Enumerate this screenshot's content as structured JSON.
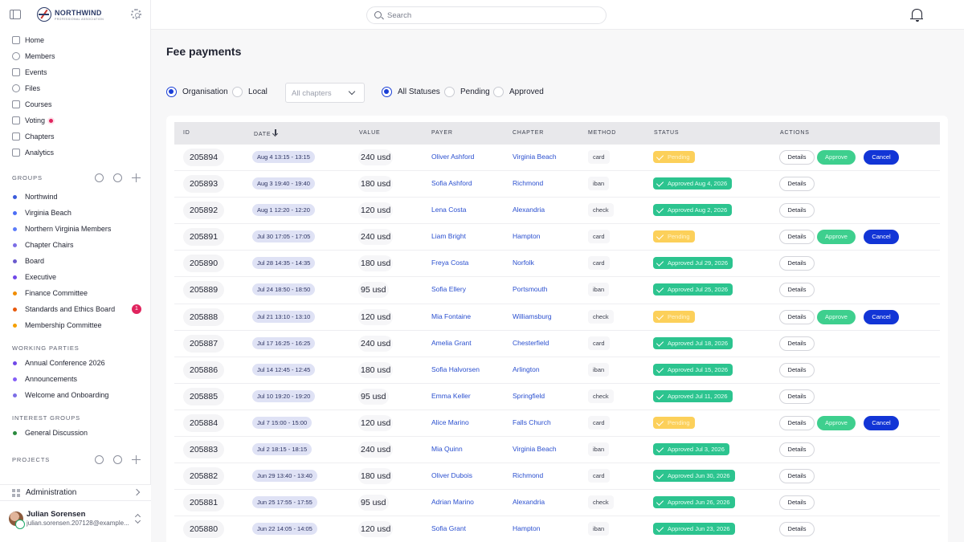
{
  "brand": {
    "name": "NORTHWIND",
    "tagline": "PROFESSIONAL ASSOCIATION"
  },
  "nav": [
    {
      "label": "Home",
      "icon": "home-icon"
    },
    {
      "label": "Members",
      "icon": "members-icon"
    },
    {
      "label": "Events",
      "icon": "calendar-icon"
    },
    {
      "label": "Files",
      "icon": "database-icon"
    },
    {
      "label": "Courses",
      "icon": "book-icon"
    },
    {
      "label": "Voting",
      "icon": "vote-icon"
    },
    {
      "label": "Chapters",
      "icon": "chapters-icon"
    },
    {
      "label": "Analytics",
      "icon": "analytics-icon"
    }
  ],
  "sections": {
    "groups": "GROUPS",
    "working_parties": "WORKING PARTIES",
    "interest_groups": "INTEREST GROUPS",
    "projects": "PROJECTS"
  },
  "groups": [
    {
      "label": "Northwind",
      "color": "#3b5bdb"
    },
    {
      "label": "Virginia Beach",
      "color": "#4c6ef5"
    },
    {
      "label": "Northern Virginia Members",
      "color": "#5c7cfa"
    },
    {
      "label": "Chapter Chairs",
      "color": "#7c6ee6"
    },
    {
      "label": "Board",
      "color": "#6a5acd"
    },
    {
      "label": "Executive",
      "color": "#7048e8"
    },
    {
      "label": "Finance Committee",
      "color": "#845ef7"
    },
    {
      "label": "Standards and Ethics Board",
      "color": "#f08c00",
      "badge": "1"
    },
    {
      "label": "Membership Committee",
      "color": "#f59f00"
    }
  ],
  "working_parties": [
    {
      "label": "Annual Conference 2026",
      "color": "#7048e8"
    },
    {
      "label": "Announcements",
      "color": "#845ef7"
    },
    {
      "label": "Welcome and Onboarding",
      "color": "#7c6ee6"
    }
  ],
  "interest_groups": [
    {
      "label": "General Discussion",
      "color": "#2b8a3e"
    }
  ],
  "admin": {
    "label": "Administration"
  },
  "user": {
    "name": "Julian Sorensen",
    "email": "julian.sorensen.207128@example..."
  },
  "search": {
    "placeholder": "Search"
  },
  "page": {
    "title": "Fee payments"
  },
  "filters": {
    "scope": [
      {
        "label": "Organisation",
        "selected": true
      },
      {
        "label": "Local",
        "selected": false
      }
    ],
    "chapter_select": "All chapters",
    "status": [
      {
        "label": "All Statuses",
        "selected": true
      },
      {
        "label": "Pending",
        "selected": false
      },
      {
        "label": "Approved",
        "selected": false
      }
    ]
  },
  "table": {
    "headers": [
      "ID",
      "DATE",
      "VALUE",
      "PAYER",
      "CHAPTER",
      "METHOD",
      "STATUS",
      "ACTIONS"
    ],
    "actions": {
      "details": "Details",
      "approve": "Approve",
      "cancel": "Cancel"
    },
    "rows": [
      {
        "id": "205894",
        "date": "Aug 4 13:15 - 13:15",
        "value": "240 usd",
        "payer": "Oliver Ashford",
        "chapter": "Virginia Beach",
        "method": "card",
        "status": "Pending",
        "pending": true
      },
      {
        "id": "205893",
        "date": "Aug 3 19:40 - 19:40",
        "value": "180 usd",
        "payer": "Sofia Ashford",
        "chapter": "Richmond",
        "method": "iban",
        "status": "Approved Aug 4, 2026",
        "pending": false
      },
      {
        "id": "205892",
        "date": "Aug 1 12:20 - 12:20",
        "value": "120 usd",
        "payer": "Lena Costa",
        "chapter": "Alexandria",
        "method": "check",
        "status": "Approved Aug 2, 2026",
        "pending": false
      },
      {
        "id": "205891",
        "date": "Jul 30 17:05 - 17:05",
        "value": "240 usd",
        "payer": "Liam Bright",
        "chapter": "Hampton",
        "method": "card",
        "status": "Pending",
        "pending": true
      },
      {
        "id": "205890",
        "date": "Jul 28 14:35 - 14:35",
        "value": "180 usd",
        "payer": "Freya Costa",
        "chapter": "Norfolk",
        "method": "card",
        "status": "Approved Jul 29, 2026",
        "pending": false
      },
      {
        "id": "205889",
        "date": "Jul 24 18:50 - 18:50",
        "value": "95 usd",
        "payer": "Sofia Ellery",
        "chapter": "Portsmouth",
        "method": "iban",
        "status": "Approved Jul 25, 2026",
        "pending": false
      },
      {
        "id": "205888",
        "date": "Jul 21 13:10 - 13:10",
        "value": "120 usd",
        "payer": "Mia Fontaine",
        "chapter": "Williamsburg",
        "method": "check",
        "status": "Pending",
        "pending": true
      },
      {
        "id": "205887",
        "date": "Jul 17 16:25 - 16:25",
        "value": "240 usd",
        "payer": "Amelia Grant",
        "chapter": "Chesterfield",
        "method": "card",
        "status": "Approved Jul 18, 2026",
        "pending": false
      },
      {
        "id": "205886",
        "date": "Jul 14 12:45 - 12:45",
        "value": "180 usd",
        "payer": "Sofia Halvorsen",
        "chapter": "Arlington",
        "method": "iban",
        "status": "Approved Jul 15, 2026",
        "pending": false
      },
      {
        "id": "205885",
        "date": "Jul 10 19:20 - 19:20",
        "value": "95 usd",
        "payer": "Emma Keller",
        "chapter": "Springfield",
        "method": "check",
        "status": "Approved Jul 11, 2026",
        "pending": false
      },
      {
        "id": "205884",
        "date": "Jul 7 15:00 - 15:00",
        "value": "120 usd",
        "payer": "Alice Marino",
        "chapter": "Falls Church",
        "method": "card",
        "status": "Pending",
        "pending": true
      },
      {
        "id": "205883",
        "date": "Jul 2 18:15 - 18:15",
        "value": "240 usd",
        "payer": "Mia Quinn",
        "chapter": "Virginia Beach",
        "method": "iban",
        "status": "Approved Jul 3, 2026",
        "pending": false
      },
      {
        "id": "205882",
        "date": "Jun 29 13:40 - 13:40",
        "value": "180 usd",
        "payer": "Oliver Dubois",
        "chapter": "Richmond",
        "method": "card",
        "status": "Approved Jun 30, 2026",
        "pending": false
      },
      {
        "id": "205881",
        "date": "Jun 25 17:55 - 17:55",
        "value": "95 usd",
        "payer": "Adrian Marino",
        "chapter": "Alexandria",
        "method": "check",
        "status": "Approved Jun 26, 2026",
        "pending": false
      },
      {
        "id": "205880",
        "date": "Jun 22 14:05 - 14:05",
        "value": "120 usd",
        "payer": "Sofia Grant",
        "chapter": "Hampton",
        "method": "iban",
        "status": "Approved Jun 23, 2026",
        "pending": false
      }
    ]
  },
  "colors": {
    "accent": "#1235d6",
    "link": "#2a4fcf",
    "approved": "#2cc48f",
    "pending": "#fcd05a"
  }
}
